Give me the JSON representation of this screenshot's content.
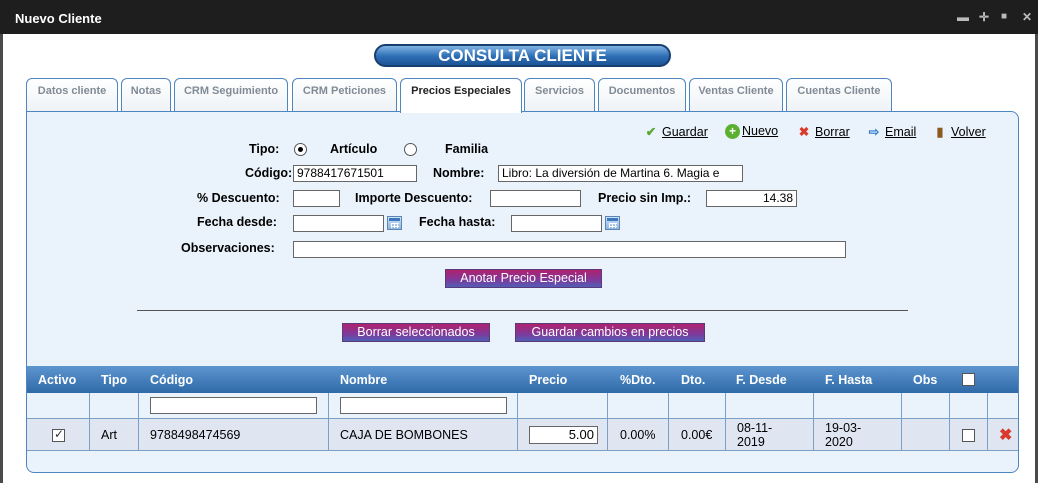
{
  "window": {
    "title": "Nuevo Cliente",
    "controls": [
      "▬",
      "✛",
      "■",
      "✕"
    ]
  },
  "header": {
    "title": "CONSULTA CLIENTE"
  },
  "tabs": [
    {
      "label": "Datos cliente"
    },
    {
      "label": "Notas"
    },
    {
      "label": "CRM Seguimiento"
    },
    {
      "label": "CRM Peticiones"
    },
    {
      "label": "Precios Especiales"
    },
    {
      "label": "Servicios"
    },
    {
      "label": "Documentos"
    },
    {
      "label": "Ventas Cliente"
    },
    {
      "label": "Cuentas Cliente"
    }
  ],
  "actions": {
    "save": "Guardar",
    "new": "Nuevo",
    "delete": "Borrar",
    "email": "Email",
    "back": "Volver"
  },
  "form": {
    "tipo_label": "Tipo:",
    "tipo_option_articulo": "Artículo",
    "tipo_option_familia": "Familia",
    "codigo_label": "Código:",
    "codigo_value": "9788417671501",
    "nombre_label": "Nombre:",
    "nombre_value": "Libro: La diversión de Martina 6. Magia e",
    "descuento_label": "% Descuento:",
    "descuento_value": "",
    "importe_descuento_label": "Importe Descuento:",
    "importe_descuento_value": "",
    "precio_sin_imp_label": "Precio sin Imp.:",
    "precio_sin_imp_value": "14.38",
    "fecha_desde_label": "Fecha desde:",
    "fecha_desde_value": "",
    "fecha_hasta_label": "Fecha hasta:",
    "fecha_hasta_value": "",
    "observaciones_label": "Observaciones:",
    "observaciones_value": ""
  },
  "buttons": {
    "anotar": "Anotar Precio Especial",
    "borrar_seleccionados": "Borrar seleccionados",
    "guardar_cambios": "Guardar cambios en precios"
  },
  "grid": {
    "columns": {
      "activo": "Activo",
      "tipo": "Tipo",
      "codigo": "Código",
      "nombre": "Nombre",
      "precio": "Precio",
      "dto_pct": "%Dto.",
      "dto": "Dto.",
      "f_desde": "F. Desde",
      "f_hasta": "F. Hasta",
      "obs": "Obs"
    },
    "filters": {
      "codigo": "",
      "nombre": ""
    },
    "rows": [
      {
        "activo": true,
        "tipo": "Art",
        "codigo": "9788498474569",
        "nombre": "CAJA DE BOMBONES",
        "precio": "5.00",
        "dto_pct": "0.00%",
        "dto": "0.00€",
        "f_desde": "08-11-2019",
        "f_desde_l1": "08-11-",
        "f_desde_l2": "2019",
        "f_hasta": "19-03-2020",
        "f_hasta_l1": "19-03-",
        "f_hasta_l2": "2020"
      }
    ]
  }
}
